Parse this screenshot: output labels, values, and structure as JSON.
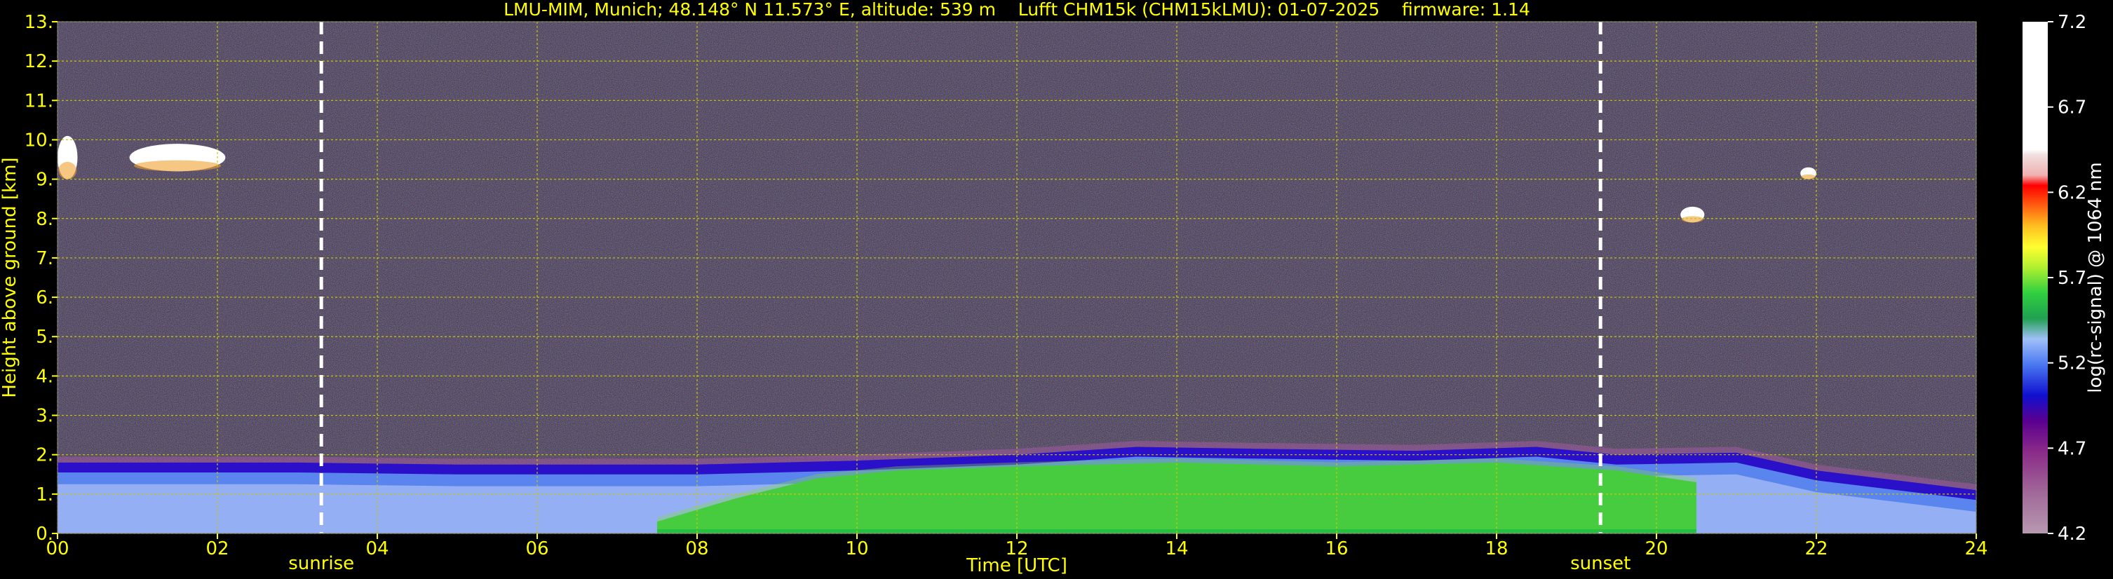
{
  "chart_data": {
    "type": "heatmap",
    "title": "LMU-MIM, Munich; 48.148° N 11.573° E, altitude: 539 m    Lufft CHM15k (CHM15kLMU): 01-07-2025    firmware: 1.14",
    "xlabel": "Time [UTC]",
    "ylabel": "Height above ground [km]",
    "xlim": [
      0,
      24
    ],
    "ylim": [
      0,
      13
    ],
    "x_ticks": [
      "00",
      "02",
      "04",
      "06",
      "08",
      "10",
      "12",
      "14",
      "16",
      "18",
      "20",
      "22",
      "24"
    ],
    "y_ticks": [
      "0.",
      "1.",
      "2.",
      "3.",
      "4.",
      "5.",
      "6.",
      "7.",
      "8.",
      "9.",
      "10.",
      "11.",
      "12.",
      "13."
    ],
    "grid": true,
    "markers": [
      {
        "label": "sunrise",
        "x": 3.3
      },
      {
        "label": "sunset",
        "x": 19.3
      }
    ],
    "colorbar": {
      "label": "log(rc-signal) @ 1064 nm",
      "range": [
        4.2,
        7.2
      ],
      "ticks": [
        "4.2",
        "4.7",
        "5.2",
        "5.7",
        "6.2",
        "6.7",
        "7.2"
      ]
    },
    "layers": {
      "aerosol_top_km": [
        {
          "x": 0,
          "y": 1.8
        },
        {
          "x": 3,
          "y": 1.8
        },
        {
          "x": 5,
          "y": 1.75
        },
        {
          "x": 8,
          "y": 1.75
        },
        {
          "x": 10,
          "y": 1.85
        },
        {
          "x": 12,
          "y": 2.0
        },
        {
          "x": 13.5,
          "y": 2.2
        },
        {
          "x": 15,
          "y": 2.15
        },
        {
          "x": 17,
          "y": 2.1
        },
        {
          "x": 18.5,
          "y": 2.2
        },
        {
          "x": 19.5,
          "y": 2.0
        },
        {
          "x": 21,
          "y": 2.05
        },
        {
          "x": 22,
          "y": 1.6
        },
        {
          "x": 24,
          "y": 1.1
        }
      ],
      "green_mixing_layer_top_km": [
        {
          "x": 7.5,
          "y": 0.3
        },
        {
          "x": 8.5,
          "y": 0.9
        },
        {
          "x": 9.5,
          "y": 1.4
        },
        {
          "x": 10.5,
          "y": 1.6
        },
        {
          "x": 12,
          "y": 1.7
        },
        {
          "x": 14,
          "y": 1.8
        },
        {
          "x": 16,
          "y": 1.7
        },
        {
          "x": 18,
          "y": 1.8
        },
        {
          "x": 19.5,
          "y": 1.6
        },
        {
          "x": 20.5,
          "y": 1.3
        }
      ],
      "cirrus_clouds": [
        {
          "x_start": 0.0,
          "x_end": 0.25,
          "base_km": 9.0,
          "top_km": 10.1
        },
        {
          "x_start": 0.9,
          "x_end": 2.1,
          "base_km": 9.2,
          "top_km": 9.9
        },
        {
          "x_start": 20.3,
          "x_end": 20.6,
          "base_km": 7.9,
          "top_km": 8.3
        },
        {
          "x_start": 21.8,
          "x_end": 22.0,
          "base_km": 9.0,
          "top_km": 9.3
        }
      ]
    }
  },
  "colors": {
    "axis_text": "#ffff00",
    "grid": "#c8c800",
    "background_noise": "#3a2c4e"
  }
}
